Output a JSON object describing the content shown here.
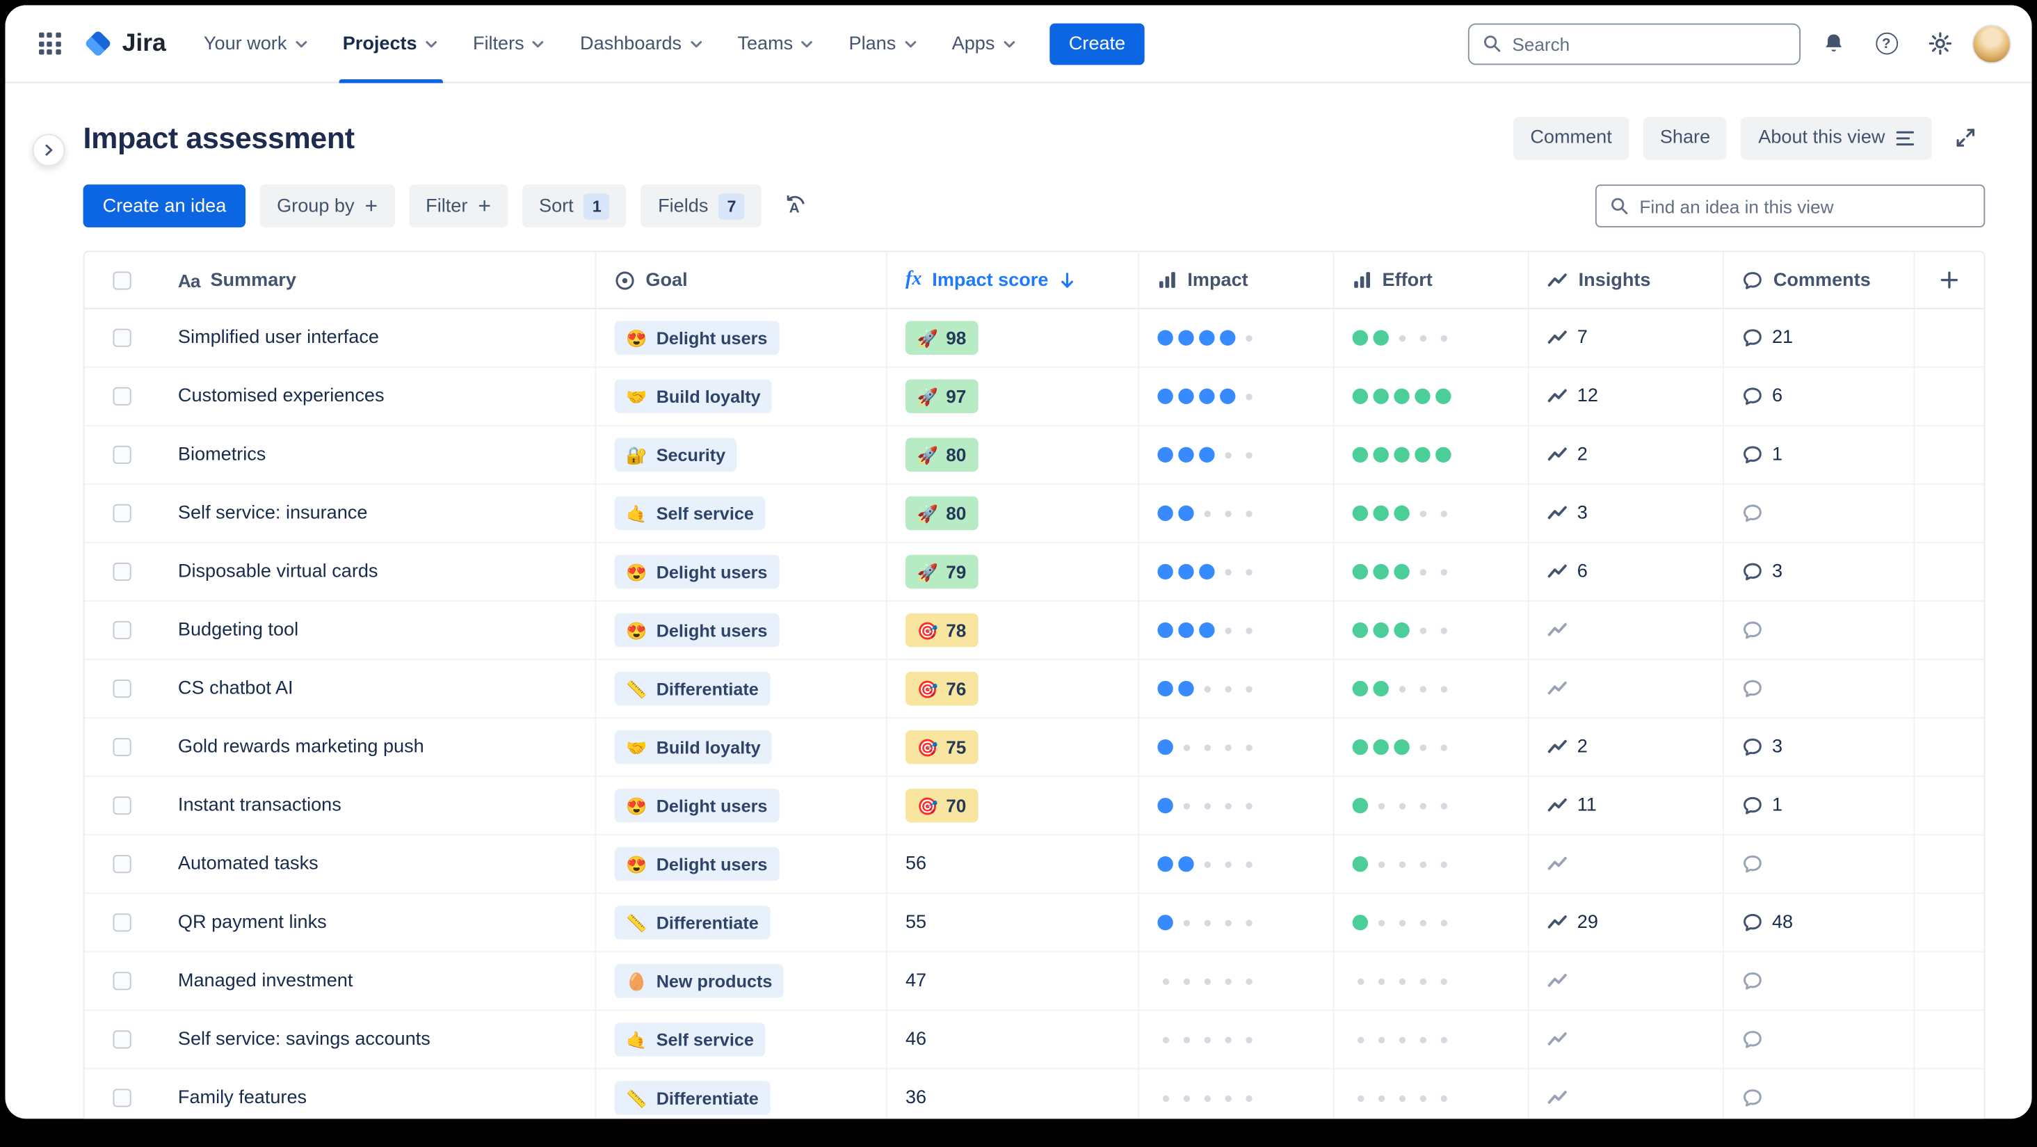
{
  "colors": {
    "accent_blue": "#0C66E4",
    "score_green": "#B7EBC4",
    "score_yellow": "#F8E6A0",
    "goal_chip": "#E8F0FB",
    "impact_dot": "#388BFF",
    "effort_dot": "#4BCE97"
  },
  "navbar": {
    "logo": "Jira",
    "items": [
      {
        "label": "Your work",
        "active": false
      },
      {
        "label": "Projects",
        "active": true
      },
      {
        "label": "Filters",
        "active": false
      },
      {
        "label": "Dashboards",
        "active": false
      },
      {
        "label": "Teams",
        "active": false
      },
      {
        "label": "Plans",
        "active": false
      },
      {
        "label": "Apps",
        "active": false
      }
    ],
    "create_label": "Create",
    "search_placeholder": "Search"
  },
  "header": {
    "title": "Impact assessment",
    "actions": {
      "comment": "Comment",
      "share": "Share",
      "about": "About this view"
    }
  },
  "toolbar": {
    "create_idea": "Create an idea",
    "group_by": "Group by",
    "filter": "Filter",
    "sort": "Sort",
    "sort_count": "1",
    "fields": "Fields",
    "fields_count": "7",
    "find_placeholder": "Find an idea in this view"
  },
  "table": {
    "columns": {
      "summary_icon": "Aa",
      "summary": "Summary",
      "goal": "Goal",
      "formula_icon": "fx",
      "impact_score": "Impact score",
      "impact": "Impact",
      "effort": "Effort",
      "insights": "Insights",
      "comments": "Comments"
    },
    "rows": [
      {
        "summary": "Simplified user interface",
        "goal_emoji": "😍",
        "goal": "Delight users",
        "score": 98,
        "score_style": "green",
        "score_emoji": "🚀",
        "impact": 4,
        "effort": 2,
        "insights": 7,
        "comments": 21
      },
      {
        "summary": "Customised experiences",
        "goal_emoji": "🤝",
        "goal": "Build loyalty",
        "score": 97,
        "score_style": "green",
        "score_emoji": "🚀",
        "impact": 4,
        "effort": 5,
        "insights": 12,
        "comments": 6
      },
      {
        "summary": "Biometrics",
        "goal_emoji": "🔐",
        "goal": "Security",
        "score": 80,
        "score_style": "green",
        "score_emoji": "🚀",
        "impact": 3,
        "effort": 5,
        "insights": 2,
        "comments": 1
      },
      {
        "summary": "Self service: insurance",
        "goal_emoji": "🤙",
        "goal": "Self service",
        "score": 80,
        "score_style": "green",
        "score_emoji": "🚀",
        "impact": 2,
        "effort": 3,
        "insights": 3,
        "comments": null
      },
      {
        "summary": "Disposable virtual cards",
        "goal_emoji": "😍",
        "goal": "Delight users",
        "score": 79,
        "score_style": "green",
        "score_emoji": "🚀",
        "impact": 3,
        "effort": 3,
        "insights": 6,
        "comments": 3
      },
      {
        "summary": "Budgeting tool",
        "goal_emoji": "😍",
        "goal": "Delight users",
        "score": 78,
        "score_style": "yellow",
        "score_emoji": "🎯",
        "impact": 3,
        "effort": 3,
        "insights": null,
        "comments": null
      },
      {
        "summary": "CS chatbot AI",
        "goal_emoji": "📏",
        "goal": "Differentiate",
        "score": 76,
        "score_style": "yellow",
        "score_emoji": "🎯",
        "impact": 2,
        "effort": 2,
        "insights": null,
        "comments": null
      },
      {
        "summary": "Gold rewards marketing push",
        "goal_emoji": "🤝",
        "goal": "Build loyalty",
        "score": 75,
        "score_style": "yellow",
        "score_emoji": "🎯",
        "impact": 1,
        "effort": 3,
        "insights": 2,
        "comments": 3
      },
      {
        "summary": "Instant transactions",
        "goal_emoji": "😍",
        "goal": "Delight users",
        "score": 70,
        "score_style": "yellow",
        "score_emoji": "🎯",
        "impact": 1,
        "effort": 1,
        "insights": 11,
        "comments": 1
      },
      {
        "summary": "Automated tasks",
        "goal_emoji": "😍",
        "goal": "Delight users",
        "score": 56,
        "score_style": "none",
        "score_emoji": "",
        "impact": 2,
        "effort": 1,
        "insights": null,
        "comments": null
      },
      {
        "summary": "QR payment links",
        "goal_emoji": "📏",
        "goal": "Differentiate",
        "score": 55,
        "score_style": "none",
        "score_emoji": "",
        "impact": 1,
        "effort": 1,
        "insights": 29,
        "comments": 48
      },
      {
        "summary": "Managed investment",
        "goal_emoji": "🥚",
        "goal": "New products",
        "score": 47,
        "score_style": "none",
        "score_emoji": "",
        "impact": 0,
        "effort": 0,
        "insights": null,
        "comments": null
      },
      {
        "summary": "Self service: savings accounts",
        "goal_emoji": "🤙",
        "goal": "Self service",
        "score": 46,
        "score_style": "none",
        "score_emoji": "",
        "impact": 0,
        "effort": 0,
        "insights": null,
        "comments": null
      },
      {
        "summary": "Family features",
        "goal_emoji": "📏",
        "goal": "Differentiate",
        "score": 36,
        "score_style": "none",
        "score_emoji": "",
        "impact": 0,
        "effort": 0,
        "insights": null,
        "comments": null
      }
    ]
  }
}
